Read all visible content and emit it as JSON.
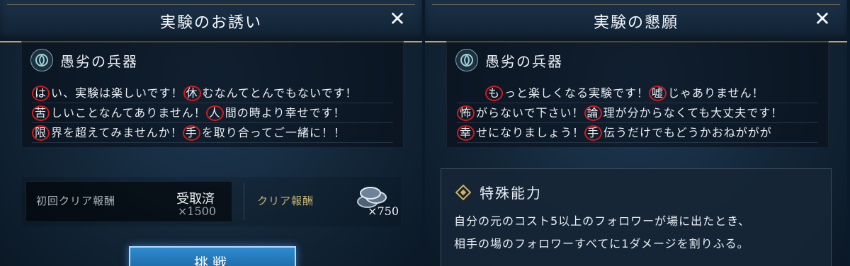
{
  "left_panel": {
    "title": "実験のお誘い",
    "close_symbol": "✕",
    "card_name": "愚劣の兵器",
    "lines": [
      [
        {
          "mark": "は",
          "rest": "い、実験は楽しいです！"
        },
        {
          "mark": "休",
          "rest": "むなんてとんでもないです！"
        }
      ],
      [
        {
          "mark": "苦",
          "rest": "しいことなんてありません！"
        },
        {
          "mark": "人",
          "rest": "間の時より幸せです！"
        }
      ],
      [
        {
          "mark": "限",
          "rest": "界を超えてみませんか！"
        },
        {
          "mark": "手",
          "rest": "を取り合ってご一緒に！！"
        }
      ]
    ],
    "first_clear_reward_label": "初回クリア報酬",
    "first_clear_status": "受取済",
    "first_clear_multiplier": "×1500",
    "clear_reward_label": "クリア報酬",
    "clear_reward_multiplier": "×750",
    "challenge_button": "挑戦"
  },
  "right_panel": {
    "title": "実験の懇願",
    "close_symbol": "✕",
    "card_name": "愚劣の兵器",
    "lines": [
      [
        {
          "mark": "も",
          "rest": "っと楽しくなる実験です！"
        },
        {
          "mark": "嘘",
          "rest": "じゃありません！"
        }
      ],
      [
        {
          "mark": "怖",
          "rest": "がらないで下さい！"
        },
        {
          "mark": "論",
          "rest": "理が分からなくても大丈夫です！"
        }
      ],
      [
        {
          "mark": "幸",
          "rest": "せになりましょう！"
        },
        {
          "mark": "手",
          "rest": "伝うだけでもどうかおねががが"
        }
      ]
    ],
    "ability_title": "特殊能力",
    "ability_lines": [
      "自分の元のコスト5以上のフォロワーが場に出たとき、",
      "相手の場のフォロワーすべてに1ダメージを割りふる。"
    ]
  },
  "colors": {
    "gold": "#c7a45a",
    "red_circle": "#d11b1b",
    "button_blue": "#2c8ccf"
  }
}
